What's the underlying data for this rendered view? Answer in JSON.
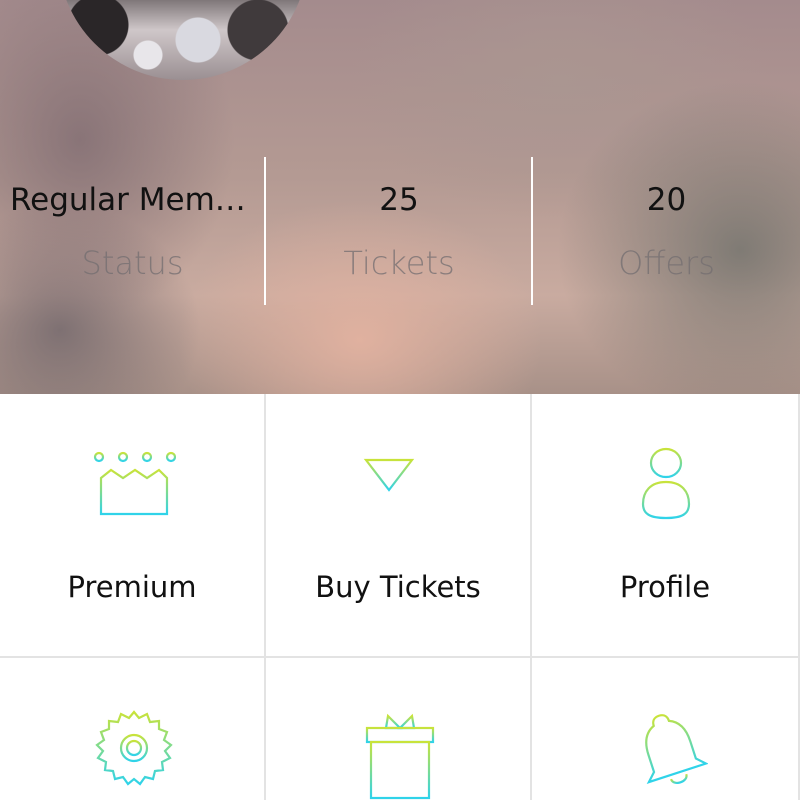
{
  "stats": [
    {
      "value": "Regular Member",
      "label": "Status"
    },
    {
      "value": "25",
      "label": "Tickets"
    },
    {
      "value": "20",
      "label": "Offers"
    }
  ],
  "menu": [
    {
      "label": "Premium",
      "icon": "crown-icon"
    },
    {
      "label": "Buy Tickets",
      "icon": "cocktail-icon"
    },
    {
      "label": "Profile",
      "icon": "person-icon"
    },
    {
      "label": "",
      "icon": "gear-icon"
    },
    {
      "label": "",
      "icon": "gift-icon"
    },
    {
      "label": "",
      "icon": "bell-icon"
    }
  ],
  "colors": {
    "gradient_top": "#c7e23a",
    "gradient_bottom": "#2ad6e8"
  }
}
